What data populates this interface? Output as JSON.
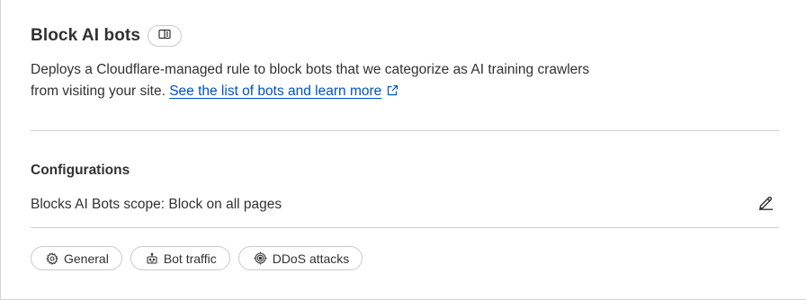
{
  "header": {
    "title": "Block AI bots",
    "doc_icon": "book-icon"
  },
  "description": {
    "text": "Deploys a Cloudflare-managed rule to block bots that we categorize as AI training crawlers from visiting your site. ",
    "link_label": "See the list of bots and learn more",
    "link_icon": "external-link-icon"
  },
  "configurations": {
    "title": "Configurations",
    "scope_text": "Blocks AI Bots scope: Block on all pages",
    "edit_icon": "pencil-icon"
  },
  "tags": [
    {
      "label": "General",
      "icon": "gear-icon"
    },
    {
      "label": "Bot traffic",
      "icon": "robot-icon"
    },
    {
      "label": "DDoS attacks",
      "icon": "target-icon"
    }
  ],
  "colors": {
    "text": "#313131",
    "link": "#0051c3",
    "border": "#c9c9c9",
    "divider": "#cfcfcf"
  }
}
